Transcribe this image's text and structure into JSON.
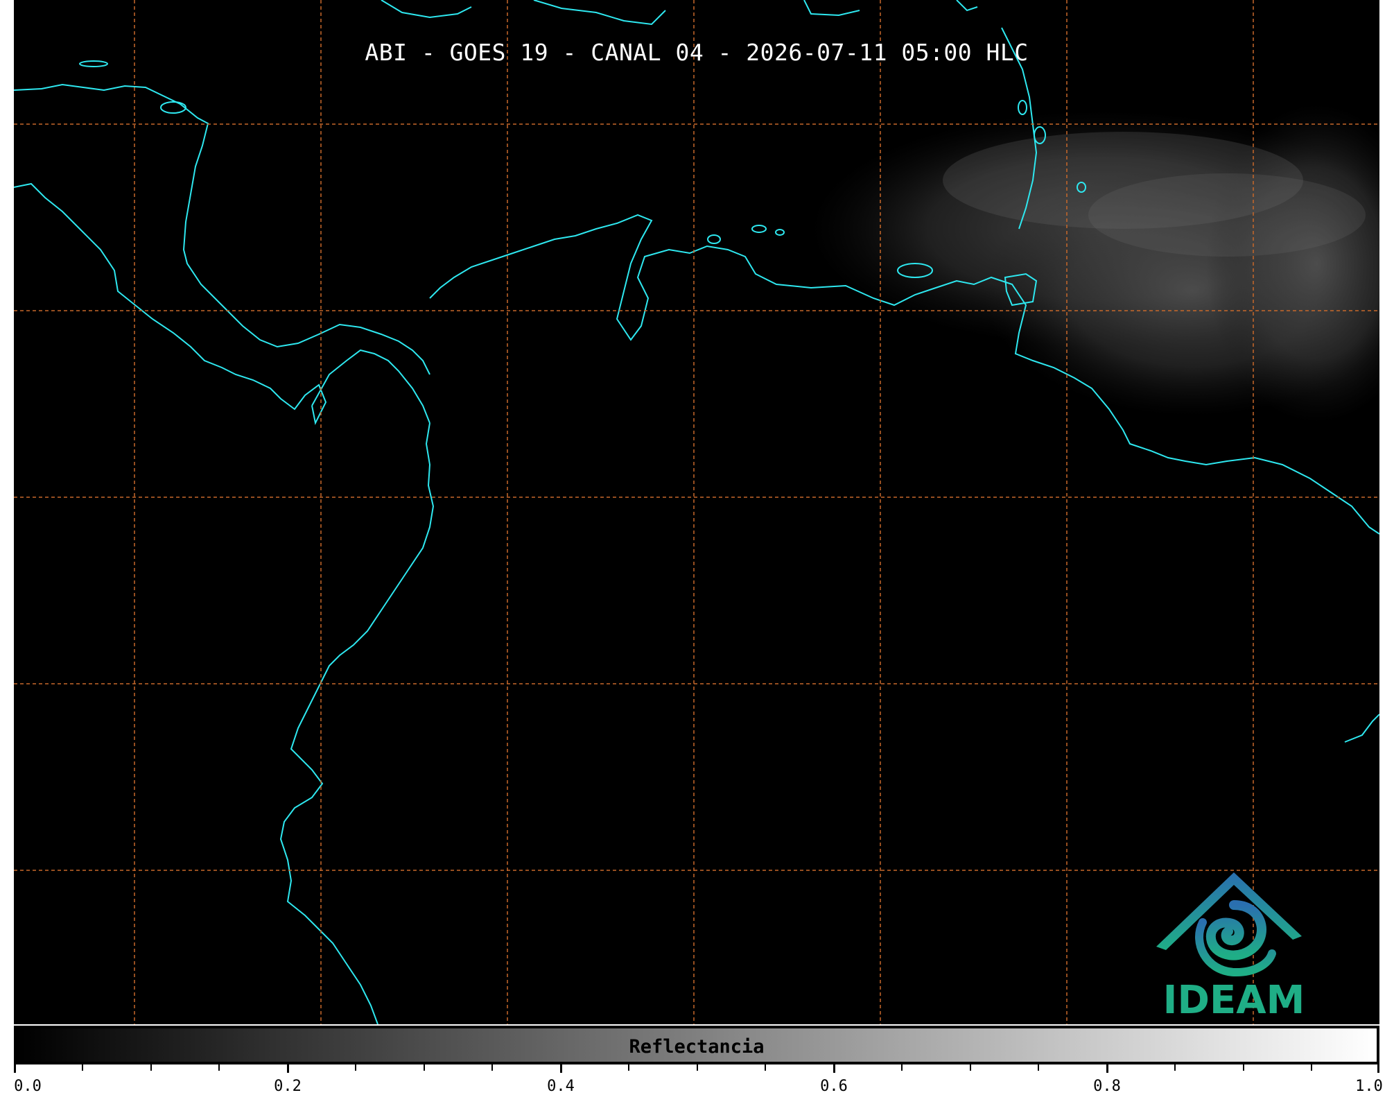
{
  "title": "ABI - GOES 19 - CANAL 04 - 2026-07-11 05:00 HLC",
  "logo_text": "IDEAM",
  "colorbar": {
    "label": "Reflectancia",
    "min": 0.0,
    "max": 1.0,
    "tick_labels": [
      "0.0",
      "0.2",
      "0.4",
      "0.6",
      "0.8",
      "1.0"
    ],
    "gradient": [
      "#000000",
      "#ffffff"
    ]
  },
  "colors": {
    "background": "#000000",
    "coastline": "#2ee8f0",
    "gridlines": "#c8682a",
    "logo_blue": "#2a6fb0",
    "logo_green": "#1fae86"
  }
}
